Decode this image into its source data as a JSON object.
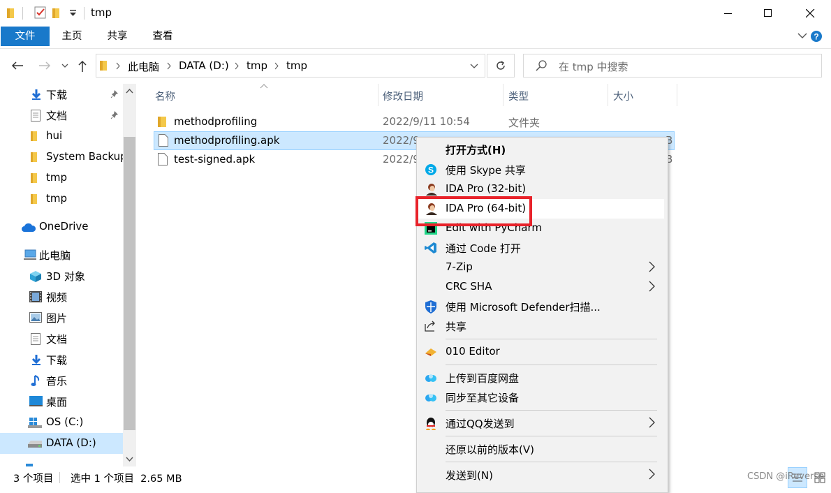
{
  "window": {
    "title": "tmp",
    "controls": [
      "minimize",
      "maximize",
      "close"
    ]
  },
  "ribbon": {
    "tabs": [
      "文件",
      "主页",
      "共享",
      "查看"
    ]
  },
  "address": {
    "crumbs": [
      "此电脑",
      "DATA (D:)",
      "tmp",
      "tmp"
    ],
    "search_placeholder": "在 tmp 中搜索"
  },
  "nav": {
    "items": [
      {
        "label": "下载",
        "icon": "download-arrow-icon",
        "pinned": true
      },
      {
        "label": "文档",
        "icon": "document-icon",
        "pinned": true
      },
      {
        "label": "hui",
        "icon": "folder-icon"
      },
      {
        "label": "System Backup",
        "icon": "folder-icon"
      },
      {
        "label": "tmp",
        "icon": "folder-icon"
      },
      {
        "label": "tmp",
        "icon": "folder-icon"
      },
      {
        "label": "OneDrive",
        "icon": "cloud-icon"
      },
      {
        "label": "此电脑",
        "icon": "computer-icon"
      },
      {
        "label": "3D 对象",
        "icon": "cube-icon"
      },
      {
        "label": "视频",
        "icon": "film-icon"
      },
      {
        "label": "图片",
        "icon": "picture-icon"
      },
      {
        "label": "文档",
        "icon": "document-icon"
      },
      {
        "label": "下载",
        "icon": "download-arrow-icon"
      },
      {
        "label": "音乐",
        "icon": "music-note-icon"
      },
      {
        "label": "桌面",
        "icon": "desktop-icon"
      },
      {
        "label": "OS (C:)",
        "icon": "windows-drive-icon"
      },
      {
        "label": "DATA (D:)",
        "icon": "drive-icon",
        "selected": true
      }
    ]
  },
  "columns": [
    "名称",
    "修改日期",
    "类型",
    "大小"
  ],
  "files": [
    {
      "name": "methodprofiling",
      "date": "2022/9/11 10:54",
      "type": "文件夹",
      "size": "",
      "icon": "folder-icon"
    },
    {
      "name": "methodprofiling.apk",
      "date": "2022/9",
      "type": "",
      "size": "B",
      "icon": "file-icon",
      "selected": true
    },
    {
      "name": "test-signed.apk",
      "date": "2022/9",
      "type": "",
      "size": "B",
      "icon": "file-icon"
    }
  ],
  "status": {
    "count": "3 个项目",
    "selection": "选中 1 个项目  2.65 MB"
  },
  "context_menu": {
    "items": [
      {
        "label": "打开方式(H)",
        "bold": true
      },
      {
        "label": "使用 Skype 共享",
        "icon": "skype-icon"
      },
      {
        "label": "IDA Pro (32-bit)",
        "icon": "ida-icon"
      },
      {
        "label": "IDA Pro (64-bit)",
        "icon": "ida-icon",
        "highlighted": true
      },
      {
        "label": "Edit with PyCharm",
        "icon": "pycharm-icon"
      },
      {
        "label": "通过 Code 打开",
        "icon": "vscode-icon"
      },
      {
        "label": "7-Zip",
        "submenu": true
      },
      {
        "label": "CRC SHA",
        "submenu": true
      },
      {
        "label": "使用 Microsoft Defender扫描...",
        "icon": "defender-shield-icon"
      },
      {
        "label": "共享",
        "icon": "share-icon"
      },
      {
        "label": "010 Editor",
        "icon": "editor-010-icon"
      },
      {
        "label": "上传到百度网盘",
        "icon": "baidu-cloud-icon"
      },
      {
        "label": "同步至其它设备",
        "icon": "baidu-cloud-icon"
      },
      {
        "label": "通过QQ发送到",
        "icon": "qq-penguin-icon",
        "submenu": true
      },
      {
        "label": "还原以前的版本(V)"
      },
      {
        "label": "发送到(N)",
        "submenu": true
      }
    ]
  },
  "watermark": "CSDN @iReverse",
  "colors": {
    "accent": "#1979ca",
    "selection": "#cce8ff",
    "highlight_box": "#e8222a",
    "folder": "#f4c84a"
  }
}
